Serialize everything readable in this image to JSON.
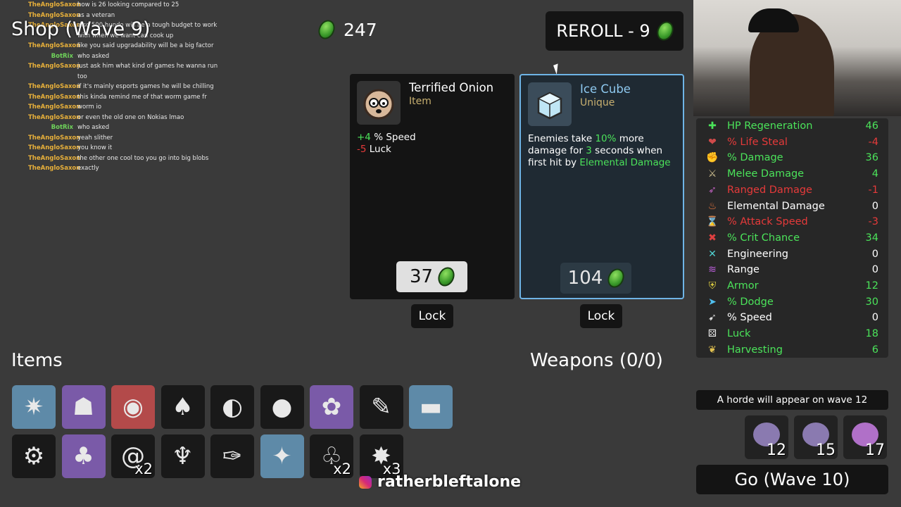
{
  "chat": [
    {
      "user": "TheAngloSaxon",
      "msg": "how is 26 looking compared to 25",
      "color": "#e8b03a"
    },
    {
      "user": "TheAngloSaxon",
      "msg": "as a veteran",
      "color": "#e8b03a"
    },
    {
      "user": "TheAngloSaxon",
      "msg": "also 500 hundo will be a tough budget to work",
      "color": "#e8b03a"
    },
    {
      "user": "",
      "msg": "with when we want can cook up",
      "color": "#e8b03a"
    },
    {
      "user": "TheAngloSaxon",
      "msg": "like you said upgradability will be a big factor",
      "color": "#e8b03a"
    },
    {
      "user": "BotRix",
      "msg": "who asked",
      "color": "#6fd35a"
    },
    {
      "user": "TheAngloSaxon",
      "msg": "just ask him what kind of games he wanna run",
      "color": "#e8b03a"
    },
    {
      "user": "",
      "msg": "too",
      "color": "#e8b03a"
    },
    {
      "user": "TheAngloSaxon",
      "msg": "if it's mainly esports games he will be chilling",
      "color": "#e8b03a"
    },
    {
      "user": "TheAngloSaxon",
      "msg": "this kinda remind me of that worm game fr",
      "color": "#e8b03a"
    },
    {
      "user": "TheAngloSaxon",
      "msg": "worm io",
      "color": "#e8b03a"
    },
    {
      "user": "TheAngloSaxon",
      "msg": "or even the old one on Nokias lmao",
      "color": "#e8b03a"
    },
    {
      "user": "BotRix",
      "msg": "who asked",
      "color": "#6fd35a"
    },
    {
      "user": "TheAngloSaxon",
      "msg": "yeah slither",
      "color": "#e8b03a"
    },
    {
      "user": "TheAngloSaxon",
      "msg": "you know it",
      "color": "#e8b03a"
    },
    {
      "user": "TheAngloSaxon",
      "msg": "the other one cool too you go into big blobs",
      "color": "#e8b03a"
    },
    {
      "user": "TheAngloSaxon",
      "msg": "exactly",
      "color": "#e8b03a"
    }
  ],
  "shop_title": "Shop (Wave 9)",
  "materials": "247",
  "reroll_label": "REROLL - 9",
  "cards": [
    {
      "name": "Terrified Onion",
      "type": "Item",
      "name_color": "#ffffff",
      "type_color": "#c8b070",
      "desc": [
        {
          "pre": "+4",
          "text": " % Speed",
          "cls": "grn"
        },
        {
          "pre": "-5",
          "text": " Luck",
          "cls": "red"
        }
      ],
      "price": "37",
      "lock": "Lock"
    },
    {
      "name": "Ice Cube",
      "type": "Unique",
      "name_color": "#8ec9f0",
      "type_color": "#c8b070",
      "desc_parts": [
        "Enemies take ",
        "10%",
        " more damage for ",
        "3",
        " seconds when first hit by ",
        "Elemental Damage"
      ],
      "price": "104",
      "lock": "Lock"
    }
  ],
  "items_title": "Items",
  "weapons_title": "Weapons (0/0)",
  "items_row1": [
    {
      "name": "ice-shard-icon",
      "tier": "blue",
      "glyph": "✷",
      "count": ""
    },
    {
      "name": "helmet-icon",
      "tier": "purple",
      "glyph": "☗",
      "count": ""
    },
    {
      "name": "alien-egg-icon",
      "tier": "red",
      "glyph": "◉",
      "count": ""
    },
    {
      "name": "mushroom-icon",
      "tier": "",
      "glyph": "♠",
      "count": ""
    },
    {
      "name": "tongue-icon",
      "tier": "",
      "glyph": "◐",
      "count": ""
    },
    {
      "name": "bee-icon",
      "tier": "",
      "glyph": "●",
      "count": ""
    },
    {
      "name": "brain-icon",
      "tier": "purple",
      "glyph": "✿",
      "count": ""
    },
    {
      "name": "syringe-icon",
      "tier": "",
      "glyph": "✎",
      "count": ""
    },
    {
      "name": "glasses-icon",
      "tier": "blue",
      "glyph": "▬",
      "count": ""
    }
  ],
  "items_row2": [
    {
      "name": "gear-icon",
      "tier": "",
      "glyph": "⚙",
      "count": ""
    },
    {
      "name": "clover-icon",
      "tier": "purple",
      "glyph": "♣",
      "count": ""
    },
    {
      "name": "snail-icon",
      "tier": "",
      "glyph": "@",
      "count": "x2"
    },
    {
      "name": "palm-tree-icon",
      "tier": "",
      "glyph": "♆",
      "count": ""
    },
    {
      "name": "injection-icon",
      "tier": "",
      "glyph": "✑",
      "count": ""
    },
    {
      "name": "robot-arm-icon",
      "tier": "blue",
      "glyph": "✦",
      "count": ""
    },
    {
      "name": "sprout-icon",
      "tier": "",
      "glyph": "♧",
      "count": "x2"
    },
    {
      "name": "dynamite-icon",
      "tier": "",
      "glyph": "✸",
      "count": "x3"
    }
  ],
  "stats": [
    {
      "name": "HP Regeneration",
      "val": "46",
      "color": "#4be35a",
      "glyph": "✚",
      "icolor": "#4be35a"
    },
    {
      "name": "% Life Steal",
      "val": "-4",
      "color": "#e63a3a",
      "glyph": "❤",
      "icolor": "#d04a4a"
    },
    {
      "name": "% Damage",
      "val": "36",
      "color": "#4be35a",
      "glyph": "✊",
      "icolor": "#e05a5a"
    },
    {
      "name": "Melee Damage",
      "val": "4",
      "color": "#4be35a",
      "glyph": "⚔",
      "icolor": "#d0c090"
    },
    {
      "name": "Ranged Damage",
      "val": "-1",
      "color": "#e63a3a",
      "glyph": "➶",
      "icolor": "#c060c0"
    },
    {
      "name": "Elemental Damage",
      "val": "0",
      "color": "#ffffff",
      "glyph": "♨",
      "icolor": "#f07a40"
    },
    {
      "name": "% Attack Speed",
      "val": "-3",
      "color": "#e63a3a",
      "glyph": "⌛",
      "icolor": "#dddddd"
    },
    {
      "name": "% Crit Chance",
      "val": "34",
      "color": "#4be35a",
      "glyph": "✖",
      "icolor": "#e04040"
    },
    {
      "name": "Engineering",
      "val": "0",
      "color": "#ffffff",
      "glyph": "✕",
      "icolor": "#50d0d0"
    },
    {
      "name": "Range",
      "val": "0",
      "color": "#ffffff",
      "glyph": "≋",
      "icolor": "#c060e0"
    },
    {
      "name": "Armor",
      "val": "12",
      "color": "#4be35a",
      "glyph": "⛨",
      "icolor": "#e0d040"
    },
    {
      "name": "% Dodge",
      "val": "30",
      "color": "#4be35a",
      "glyph": "➤",
      "icolor": "#50c0f0"
    },
    {
      "name": "% Speed",
      "val": "0",
      "color": "#ffffff",
      "glyph": "➹",
      "icolor": "#dddddd"
    },
    {
      "name": "Luck",
      "val": "18",
      "color": "#4be35a",
      "glyph": "⚄",
      "icolor": "#eeeeee"
    },
    {
      "name": "Harvesting",
      "val": "6",
      "color": "#4be35a",
      "glyph": "❦",
      "icolor": "#e0c050"
    }
  ],
  "horde_text": "A horde will appear on wave 12",
  "enemies": [
    {
      "count": "12",
      "name": "enemy-bug-icon",
      "color": "#8a7ab0"
    },
    {
      "count": "15",
      "name": "enemy-bug-icon",
      "color": "#8a7ab0"
    },
    {
      "count": "17",
      "name": "enemy-demon-icon",
      "color": "#b070c8"
    }
  ],
  "go_label": "Go (Wave 10)",
  "streamer_handle": "ratherbleftalone"
}
